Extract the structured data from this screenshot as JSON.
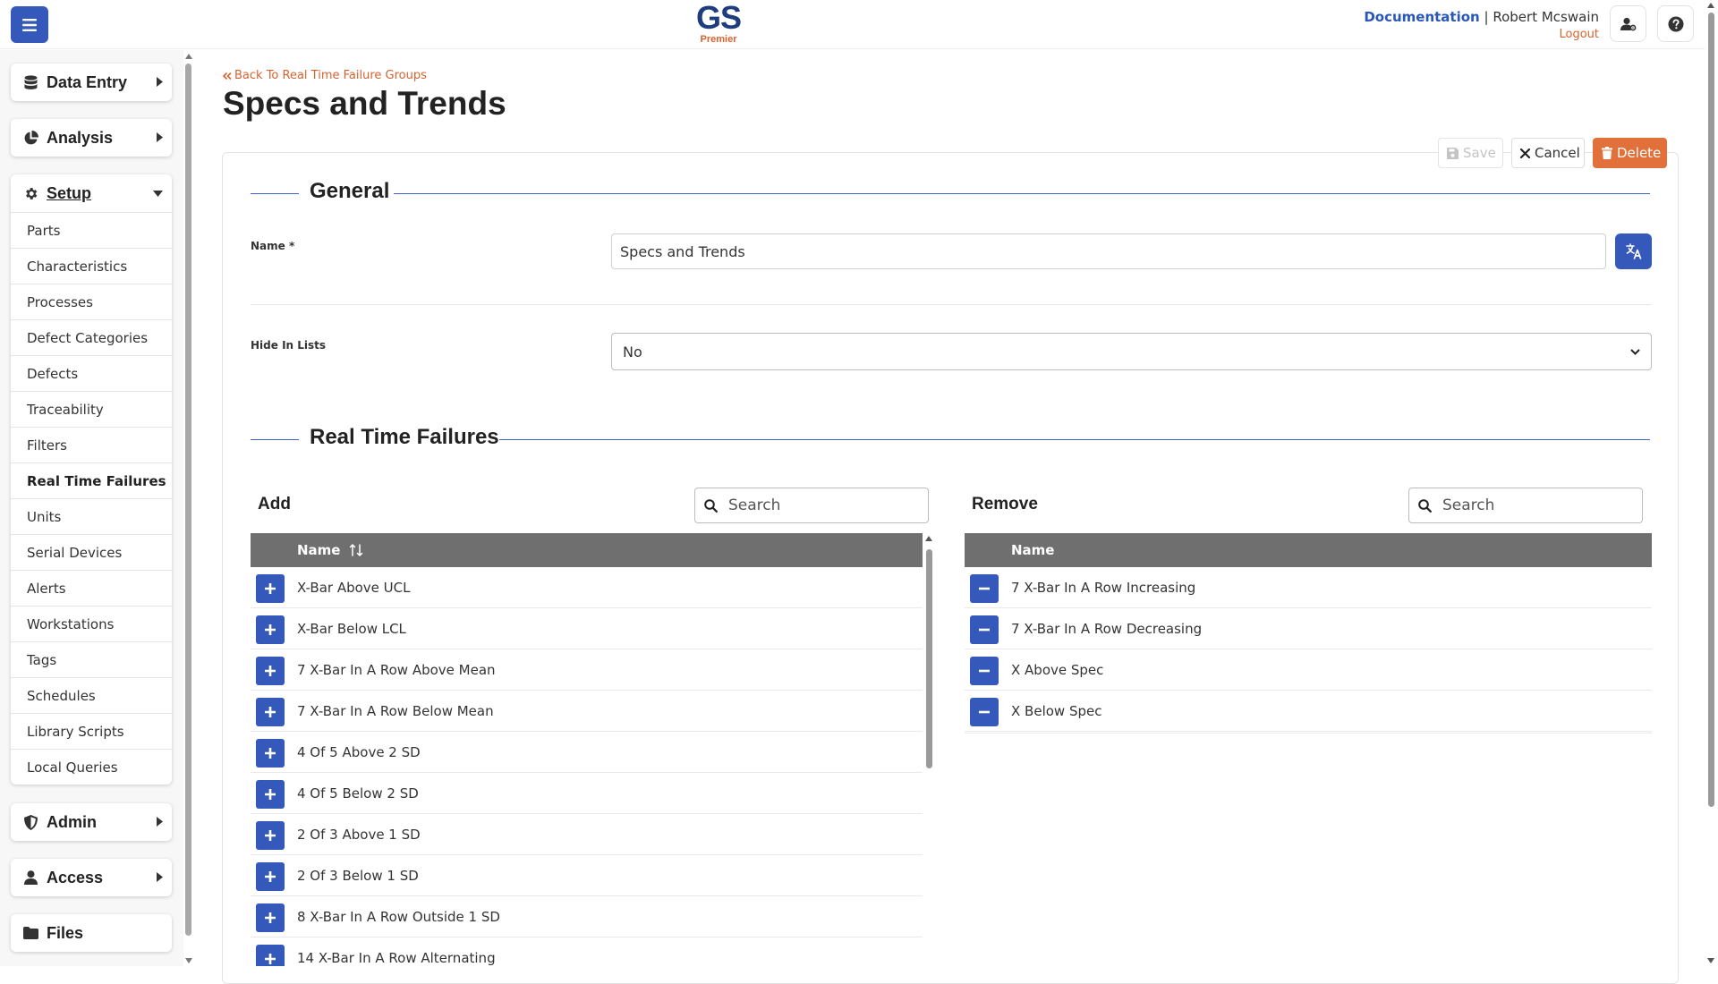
{
  "header": {
    "logo_main": "GS",
    "logo_sub": "Premier",
    "documentation": "Documentation",
    "separator": "|",
    "user_name": "Robert Mcswain",
    "logout": "Logout",
    "icons": [
      "menu-icon",
      "user-settings-icon",
      "help-icon"
    ]
  },
  "sidebar": {
    "data_entry": "Data Entry",
    "analysis": "Analysis",
    "setup": {
      "label": "Setup",
      "items": [
        "Parts",
        "Characteristics",
        "Processes",
        "Defect Categories",
        "Defects",
        "Traceability",
        "Filters",
        "Real Time Failures",
        "Units",
        "Serial Devices",
        "Alerts",
        "Workstations",
        "Tags",
        "Schedules",
        "Library Scripts",
        "Local Queries"
      ],
      "active": "Real Time Failures"
    },
    "admin": "Admin",
    "access": "Access",
    "files": "Files"
  },
  "page": {
    "back_link": "Back To Real Time Failure Groups",
    "title": "Specs and Trends",
    "save": "Save",
    "cancel": "Cancel",
    "delete": "Delete"
  },
  "general": {
    "heading": "General",
    "name_label": "Name *",
    "name_value": "Specs and Trends",
    "hide_label": "Hide In Lists",
    "hide_value": "No"
  },
  "failures": {
    "heading": "Real Time Failures",
    "add_label": "Add",
    "remove_label": "Remove",
    "search_placeholder": "Search",
    "name_column": "Name",
    "add_items": [
      "X-Bar Above UCL",
      "X-Bar Below LCL",
      "7 X-Bar In A Row Above Mean",
      "7 X-Bar In A Row Below Mean",
      "4 Of 5 Above 2 SD",
      "4 Of 5 Below 2 SD",
      "2 Of 3 Above 1 SD",
      "2 Of 3 Below 1 SD",
      "8 X-Bar In A Row Outside 1 SD",
      "14 X-Bar In A Row Alternating"
    ],
    "remove_items": [
      "7 X-Bar In A Row Increasing",
      "7 X-Bar In A Row Decreasing",
      "X Above Spec",
      "X Below Spec"
    ]
  },
  "colors": {
    "primary_blue": "#3558bb",
    "accent_orange": "#d8622e",
    "delete_orange": "#e2703a",
    "table_header": "#6f6f6f",
    "section_line": "#3f63c7"
  }
}
